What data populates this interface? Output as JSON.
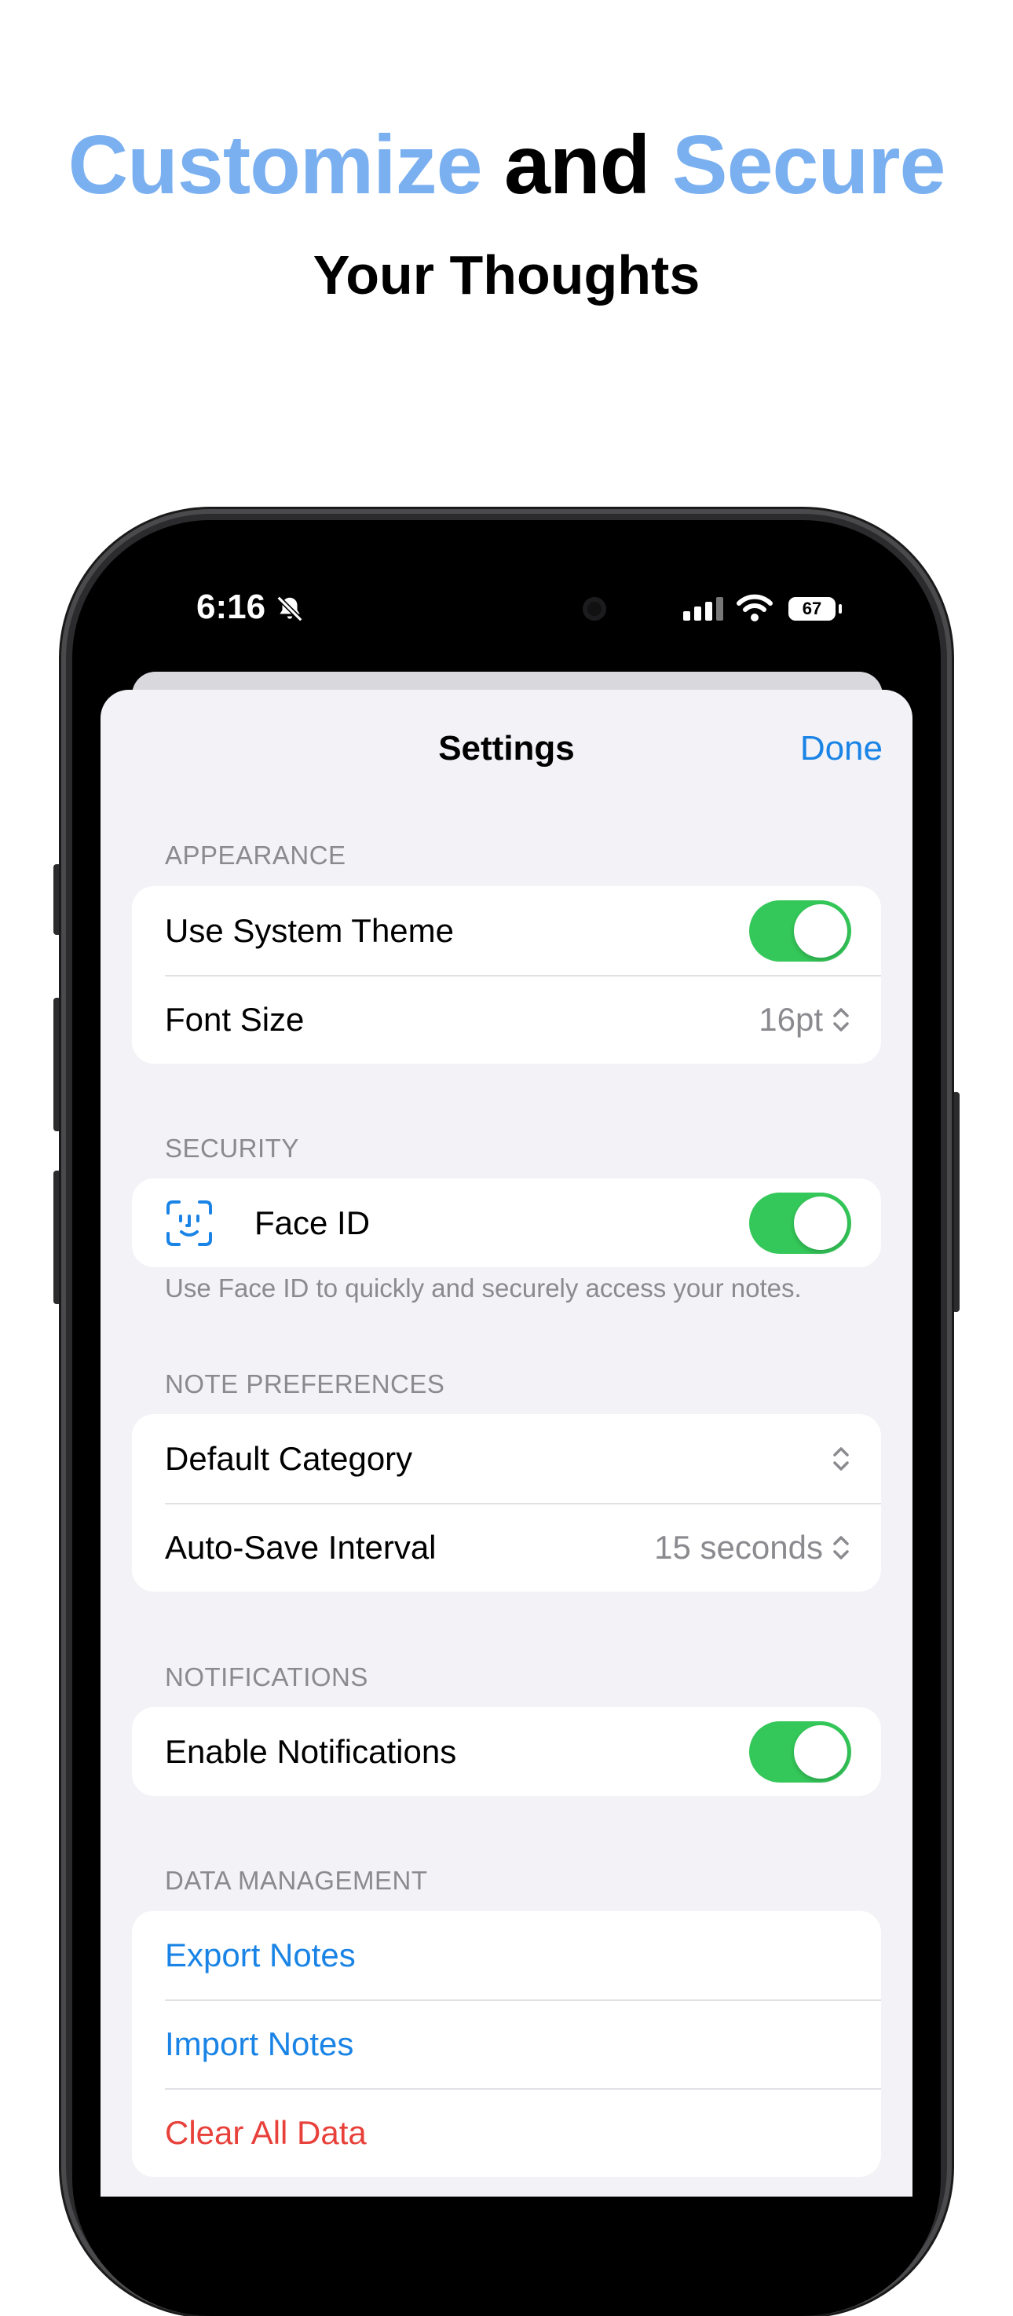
{
  "headline": {
    "word1": "Customize",
    "word2": "and",
    "word3": "Secure",
    "subtitle": "Your Thoughts",
    "accent_color": "#7ab0f0"
  },
  "status_bar": {
    "time": "6:16",
    "battery": "67",
    "icons": [
      "bell-slash-icon",
      "signal-icon",
      "wifi-icon",
      "battery-icon"
    ]
  },
  "nav": {
    "title": "Settings",
    "done_label": "Done"
  },
  "sections": {
    "appearance": {
      "header": "APPEARANCE",
      "use_system_theme": {
        "label": "Use System Theme",
        "on": true
      },
      "font_size": {
        "label": "Font Size",
        "value": "16pt"
      }
    },
    "security": {
      "header": "SECURITY",
      "face_id": {
        "label": "Face ID",
        "on": true
      },
      "footer": "Use Face ID to quickly and securely access your notes."
    },
    "note_preferences": {
      "header": "NOTE PREFERENCES",
      "default_category": {
        "label": "Default Category",
        "value": ""
      },
      "auto_save": {
        "label": "Auto-Save Interval",
        "value": "15 seconds"
      }
    },
    "notifications": {
      "header": "NOTIFICATIONS",
      "enable": {
        "label": "Enable Notifications",
        "on": true
      }
    },
    "data_management": {
      "header": "DATA MANAGEMENT",
      "export": "Export Notes",
      "import": "Import Notes",
      "clear": "Clear All Data"
    }
  },
  "colors": {
    "tint": "#1a84e6",
    "toggle_on": "#34c759",
    "destructive": "#e8403a",
    "grouped_background": "#f2f2f7"
  }
}
